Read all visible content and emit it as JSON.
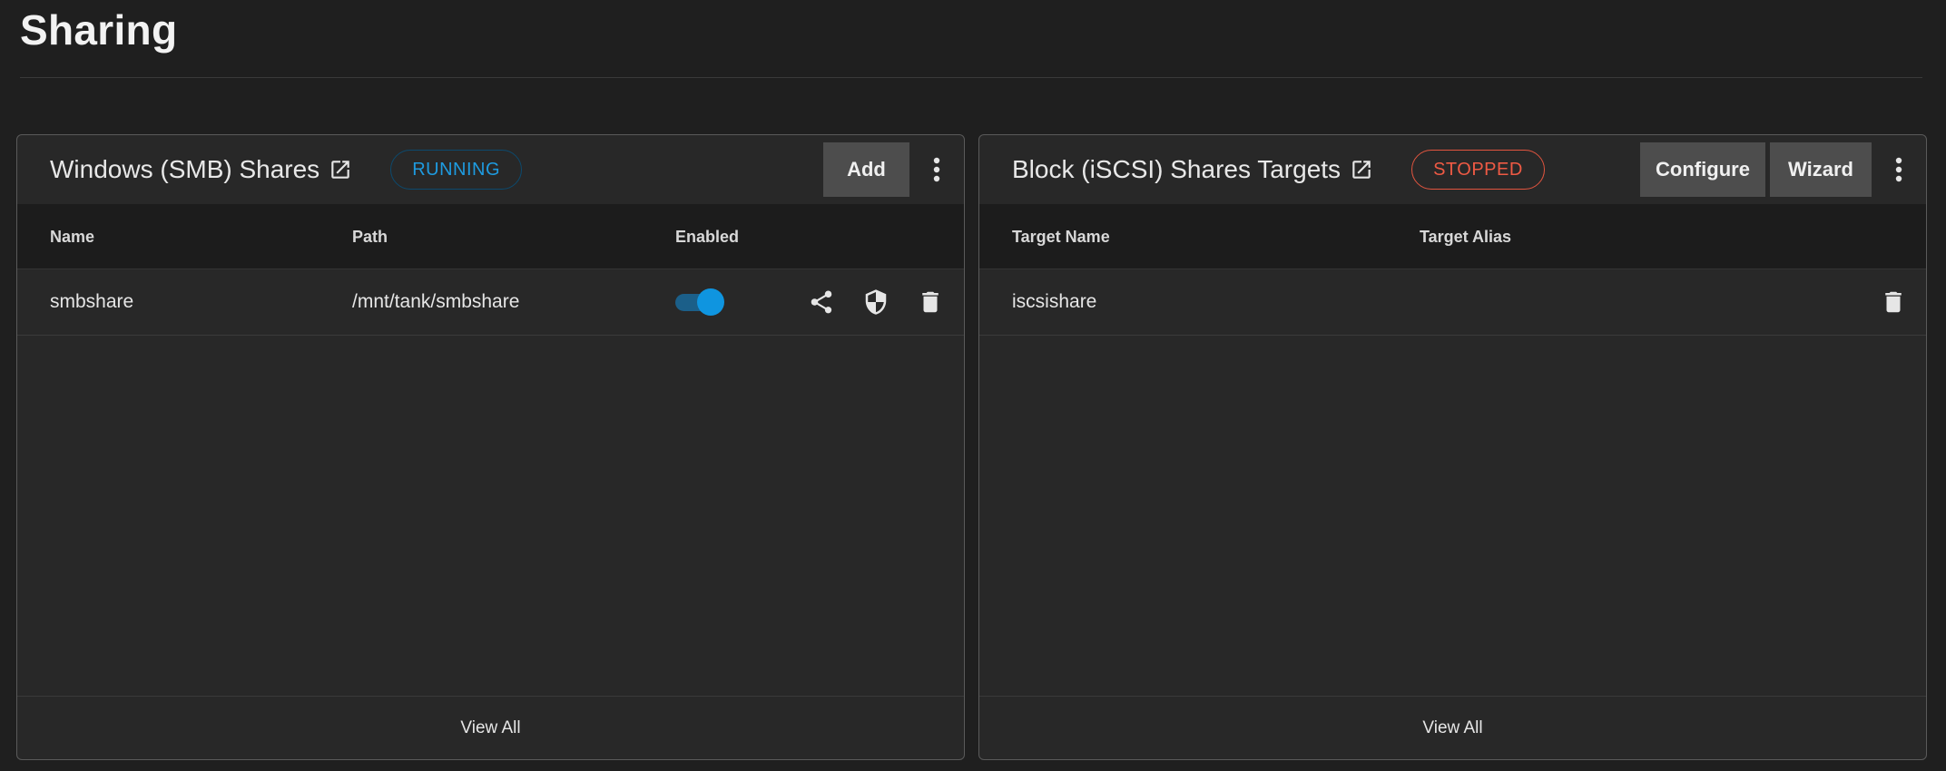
{
  "page": {
    "title": "Sharing"
  },
  "smb": {
    "title": "Windows (SMB) Shares",
    "status": "RUNNING",
    "add_label": "Add",
    "columns": {
      "name": "Name",
      "path": "Path",
      "enabled": "Enabled"
    },
    "rows": [
      {
        "name": "smbshare",
        "path": "/mnt/tank/smbshare",
        "enabled": true
      }
    ],
    "footer": "View All"
  },
  "iscsi": {
    "title": "Block (iSCSI) Shares Targets",
    "status": "STOPPED",
    "configure_label": "Configure",
    "wizard_label": "Wizard",
    "columns": {
      "target_name": "Target Name",
      "target_alias": "Target Alias"
    },
    "rows": [
      {
        "target_name": "iscsishare",
        "target_alias": ""
      }
    ],
    "footer": "View All"
  },
  "colors": {
    "running": "#1e9be0",
    "stopped": "#ef5a44",
    "toggle_on": "#0f95e0"
  },
  "icons": {
    "external_link": "open-in-new-icon",
    "more": "dots-vertical-icon",
    "share": "share-icon",
    "shield": "shield-icon",
    "delete": "trash-icon"
  }
}
